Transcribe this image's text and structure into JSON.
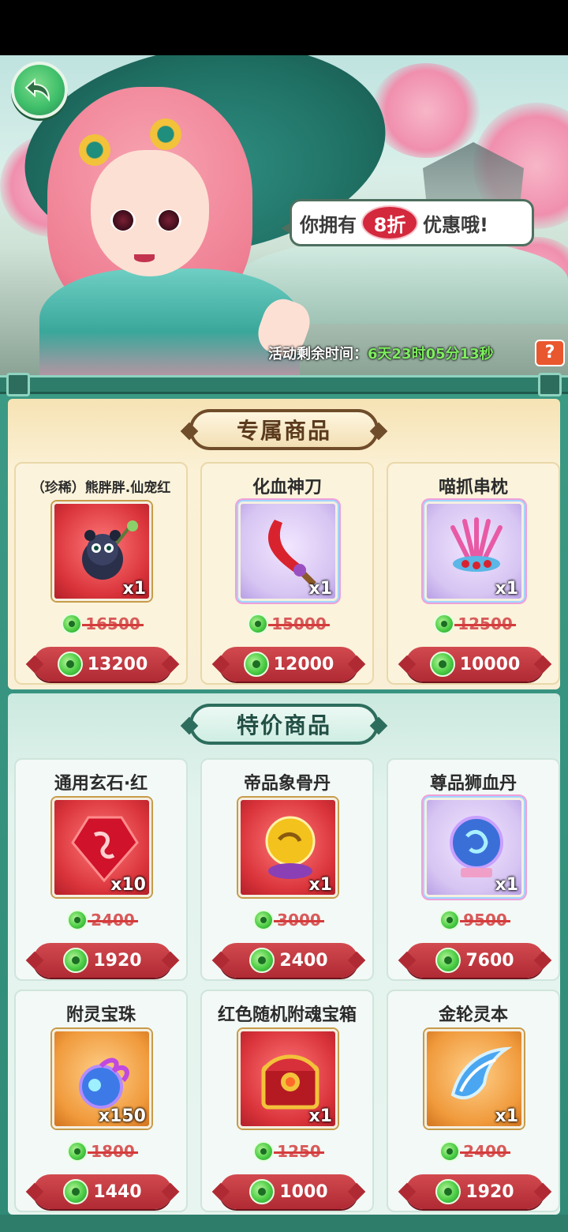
{
  "banner": {
    "bubble_prefix": "你拥有",
    "discount": "8折",
    "bubble_suffix": "优惠哦!",
    "timer_label": "活动剩余时间：",
    "timer_value": "6天23时05分13秒",
    "help_label": "?"
  },
  "sections": {
    "exclusive_title": "专属商品",
    "special_title": "特价商品"
  },
  "exclusive_items": [
    {
      "name": "（珍稀）熊胖胖.仙宠红",
      "qty": "x1",
      "old_price": "16500",
      "price": "13200",
      "icon": "panda-pet-icon",
      "frame": "red"
    },
    {
      "name": "化血神刀",
      "qty": "x1",
      "old_price": "15000",
      "price": "12000",
      "icon": "blood-blade-icon",
      "frame": "purple"
    },
    {
      "name": "喵抓串枕",
      "qty": "x1",
      "old_price": "12500",
      "price": "10000",
      "icon": "claw-skewer-icon",
      "frame": "purple"
    }
  ],
  "special_items": [
    {
      "name": "通用玄石·红",
      "qty": "x10",
      "old_price": "2400",
      "price": "1920",
      "icon": "red-gem-icon",
      "frame": "red"
    },
    {
      "name": "帝品象骨丹",
      "qty": "x1",
      "old_price": "3000",
      "price": "2400",
      "icon": "golden-pill-icon",
      "frame": "red"
    },
    {
      "name": "尊品狮血丹",
      "qty": "x1",
      "old_price": "9500",
      "price": "7600",
      "icon": "lion-orb-icon",
      "frame": "purple"
    },
    {
      "name": "附灵宝珠",
      "qty": "x150",
      "old_price": "1800",
      "price": "1440",
      "icon": "spirit-orb-icon",
      "frame": "orange"
    },
    {
      "name": "红色随机附魂宝箱",
      "qty": "x1",
      "old_price": "1250",
      "price": "1000",
      "icon": "treasure-chest-icon",
      "frame": "red"
    },
    {
      "name": "金轮灵本",
      "qty": "x1",
      "old_price": "2400",
      "price": "1920",
      "icon": "blue-blade-icon",
      "frame": "orange"
    }
  ]
}
